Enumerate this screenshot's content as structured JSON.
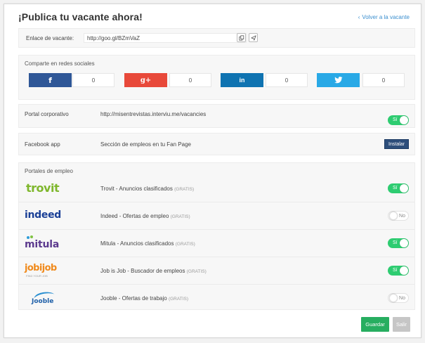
{
  "header": {
    "title": "¡Publica tu vacante ahora!",
    "back_chevron": "‹",
    "back_link": "Volver a la vacante"
  },
  "url": {
    "label": "Enlace de vacante:",
    "value": "http://goo.gl/BZmVaZ",
    "copy_icon": "copy-icon",
    "send_icon": "send-icon"
  },
  "social": {
    "title": "Comparte en redes sociales",
    "networks": [
      {
        "name": "facebook",
        "glyph": "f",
        "color": "#2f5797",
        "count": "0"
      },
      {
        "name": "google-plus",
        "glyph": "g+",
        "color": "#e8493a",
        "count": "0"
      },
      {
        "name": "linkedin",
        "glyph": "in",
        "color": "#0f73b1",
        "count": "0"
      },
      {
        "name": "twitter",
        "glyph": "🐦",
        "color": "#29a9e6",
        "count": "0"
      }
    ]
  },
  "corporate": {
    "label": "Portal corporativo",
    "value": "http://misentrevistas.interviu.me/vacancies",
    "toggle": "Sí",
    "on": true
  },
  "facebook_app": {
    "label": "Facebook app",
    "value": "Sección de empleos en tu Fan Page",
    "button": "Instalar"
  },
  "portals": {
    "title": "Portales de empleo",
    "items": [
      {
        "logo_text": "trovit",
        "name": "Trovit - Anuncios clasificados",
        "gratis": "(GRATIS)",
        "toggle": "Sí",
        "on": true
      },
      {
        "logo_text": "indeed",
        "name": "Indeed - Ofertas de empleo",
        "gratis": "(GRATIS)",
        "toggle": "No",
        "on": false
      },
      {
        "logo_text": "mitula",
        "name": "Mitula - Anuncios clasificados",
        "gratis": "(GRATIS)",
        "toggle": "Sí",
        "on": true
      },
      {
        "logo_text": "jobijob",
        "logo_subtext": "FIND YOUR JOB",
        "name": "Job is Job - Buscador de empleos",
        "gratis": "(GRATIS)",
        "toggle": "Sí",
        "on": true
      },
      {
        "logo_text": "Jooble",
        "name": "Jooble - Ofertas de trabajo",
        "gratis": "(GRATIS)",
        "toggle": "No",
        "on": false
      }
    ]
  },
  "footer": {
    "save": "Guardar",
    "exit": "Salir"
  },
  "colors": {
    "toggle_on": "#2ecc71",
    "save": "#27ae60",
    "link": "#3b8fcf",
    "install": "#2d4e7b"
  }
}
